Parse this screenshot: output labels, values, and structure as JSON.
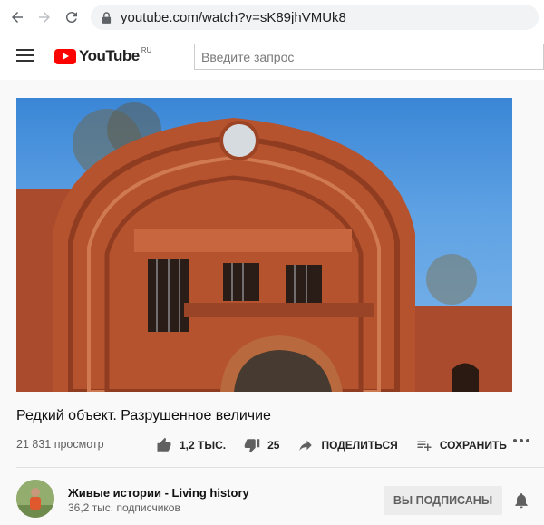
{
  "browser": {
    "url": "youtube.com/watch?v=sK89jhVMUk8"
  },
  "header": {
    "logo_text": "YouTube",
    "logo_region": "RU",
    "search_placeholder": "Введите запрос"
  },
  "video": {
    "title": "Редкий объект. Разрушенное величие",
    "views": "21 831 просмотр"
  },
  "actions": {
    "like_count": "1,2 ТЫС.",
    "dislike_count": "25",
    "share_label": "ПОДЕЛИТЬСЯ",
    "save_label": "СОХРАНИТЬ"
  },
  "channel": {
    "name": "Живые истории - Living history",
    "subscribers": "36,2 тыс. подписчиков",
    "subscribe_label": "ВЫ ПОДПИСАНЫ"
  },
  "colors": {
    "brand_red": "#ff0000",
    "brick": "#b5532f",
    "sky": "#4a90d9"
  }
}
